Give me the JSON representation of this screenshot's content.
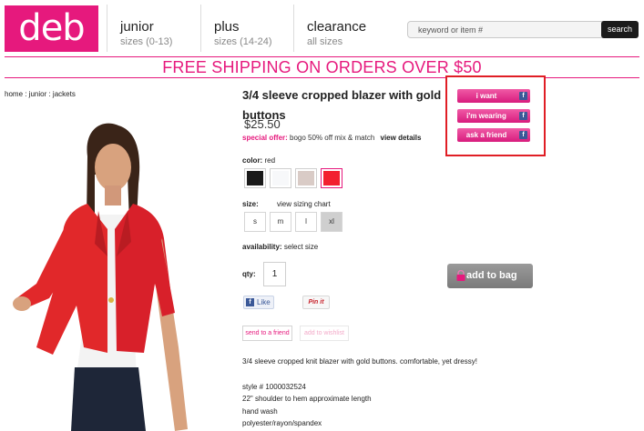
{
  "header": {
    "logo": "deb",
    "nav": [
      {
        "label": "junior",
        "sub": "sizes (0-13)"
      },
      {
        "label": "plus",
        "sub": "sizes (14-24)"
      },
      {
        "label": "clearance",
        "sub": "all sizes"
      }
    ],
    "search": {
      "placeholder": "keyword or item #",
      "button": "search"
    }
  },
  "banner": {
    "part1": "FREE SHIPPING",
    "part2": "ON ORDERS OVER $50"
  },
  "breadcrumb": "home : junior : jackets",
  "product": {
    "title": "3/4 sleeve cropped blazer with gold buttons",
    "price": "$25.50",
    "offer": {
      "label": "special offer:",
      "text": "bogo 50% off mix & match",
      "link": "view details"
    },
    "color": {
      "label": "color:",
      "value": "red",
      "swatches": [
        "#1a1a1a",
        "#f7f8fa",
        "#d9cbc6",
        "#f2202f"
      ],
      "selected_index": 3
    },
    "size": {
      "label": "size:",
      "chart_link": "view sizing chart",
      "options": [
        "s",
        "m",
        "l",
        "xl"
      ],
      "selected": "xl"
    },
    "availability": {
      "label": "availability:",
      "value": "select size"
    },
    "qty": {
      "label": "qty:",
      "value": "1"
    },
    "add_to_bag": "add to bag",
    "like": "Like",
    "pin": "Pin it",
    "send_to_friend": "send to a friend",
    "add_to_wishlist": "add to wishlist",
    "description": "3/4 sleeve cropped knit blazer with gold buttons. comfortable, yet dressy!",
    "details": [
      "style # 1000032524",
      "22\" shoulder to hem approximate length",
      "hand wash",
      "polyester/rayon/spandex"
    ]
  },
  "social": {
    "buttons": [
      "i want",
      "i'm wearing",
      "ask a friend"
    ]
  },
  "colors": {
    "brand_pink": "#e6197d",
    "highlight_red": "#e01e25",
    "facebook_blue": "#3b5998"
  }
}
